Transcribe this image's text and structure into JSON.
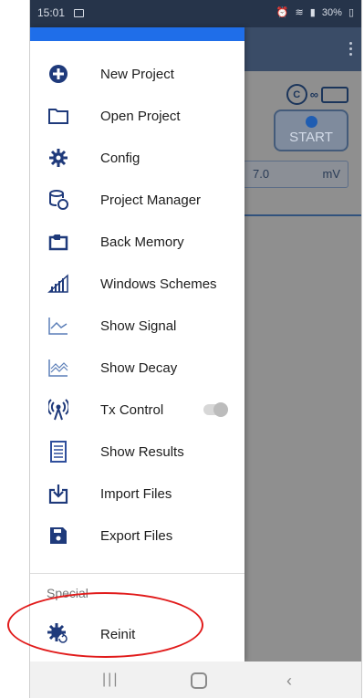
{
  "status_bar": {
    "time": "15:01",
    "battery": "30%"
  },
  "drawer": {
    "items": [
      {
        "label": "New Project",
        "icon": "plus-circle-icon"
      },
      {
        "label": "Open Project",
        "icon": "folder-icon"
      },
      {
        "label": "Config",
        "icon": "gear-icon"
      },
      {
        "label": "Project Manager",
        "icon": "database-icon"
      },
      {
        "label": "Back Memory",
        "icon": "back-memory-icon"
      },
      {
        "label": "Windows Schemes",
        "icon": "signal-bars-icon"
      },
      {
        "label": "Show Signal",
        "icon": "signal-chart-icon"
      },
      {
        "label": "Show Decay",
        "icon": "decay-chart-icon"
      },
      {
        "label": "Tx Control",
        "icon": "antenna-icon",
        "toggle": false
      },
      {
        "label": "Show Results",
        "icon": "results-list-icon"
      },
      {
        "label": "Import Files",
        "icon": "import-icon"
      },
      {
        "label": "Export Files",
        "icon": "save-icon"
      }
    ],
    "section_title": "Special",
    "special_item": {
      "label": "Reinit",
      "icon": "reinit-gear-icon"
    }
  },
  "main": {
    "start_label": "START",
    "field_value": "7.0",
    "field_unit": "mV"
  },
  "colors": {
    "accent": "#1f6ee9",
    "icon": "#1f3a7b",
    "highlight": "#e11b1b"
  }
}
